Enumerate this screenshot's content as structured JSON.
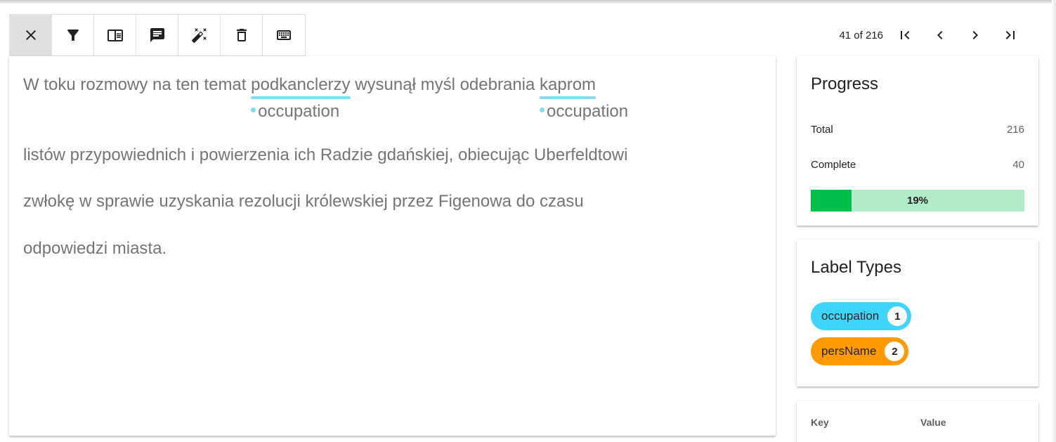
{
  "toolbar": {
    "buttons": [
      {
        "name": "close",
        "icon": "close-icon"
      },
      {
        "name": "filter",
        "icon": "filter-icon"
      },
      {
        "name": "layout",
        "icon": "layout-icon"
      },
      {
        "name": "comment",
        "icon": "comment-icon"
      },
      {
        "name": "auto-labeling",
        "icon": "magic-wand-icon"
      },
      {
        "name": "delete",
        "icon": "delete-icon"
      },
      {
        "name": "keyboard",
        "icon": "keyboard-icon"
      }
    ]
  },
  "pager": {
    "text": "41 of 216",
    "current": 41,
    "total": 216
  },
  "document": {
    "line1_before": "W toku rozmowy na ten temat ",
    "entity1": "podkanclerzy",
    "entity1_label": "occupation",
    "line1_middle": " wysunął myśl odebrania ",
    "entity2": "kaprom",
    "entity2_label": "occupation",
    "line2": "listów przypowiednich i powierzenia ich Radzie gdańskiej, obiecując Uberfeldtowi",
    "line3": "zwłokę w sprawie uzyskania rezolucji królewskiej przez Figenowa do czasu",
    "line4": "odpowiedzi miasta."
  },
  "progress": {
    "title": "Progress",
    "total_label": "Total",
    "total_value": "216",
    "complete_label": "Complete",
    "complete_value": "40",
    "percent_text": "19%",
    "percent": 0.19
  },
  "label_types": {
    "title": "Label Types",
    "items": [
      {
        "name": "occupation",
        "count": "1",
        "color": "#3fd4fb"
      },
      {
        "name": "persName",
        "count": "2",
        "color": "#ff9a00"
      }
    ]
  },
  "metadata": {
    "key_header": "Key",
    "value_header": "Value"
  },
  "colors": {
    "entity_underline": "#7fdcfd",
    "progress_fill": "#00c04b",
    "progress_track": "#b2ebc7"
  }
}
